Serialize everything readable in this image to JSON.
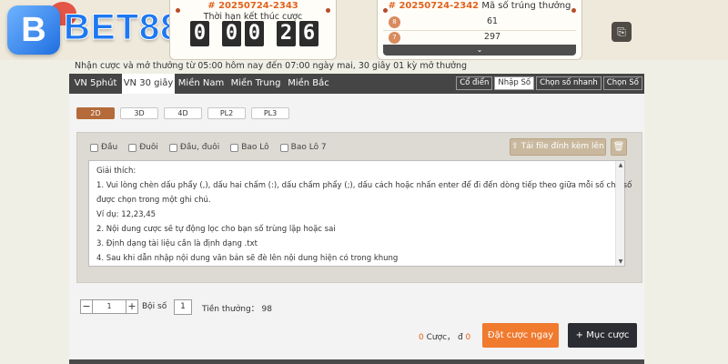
{
  "brand": {
    "logo_text": "BET88",
    "logo_mark": "B"
  },
  "current_round": {
    "id": "# 20250724-2343",
    "label": "Thời hạn kết thúc cược",
    "timer": [
      "0",
      "0",
      "0",
      "2",
      "6"
    ]
  },
  "last_result": {
    "id": "# 20250724-2342",
    "label": "Mã số trúng thưởng",
    "rows": [
      {
        "ball": "8",
        "value": "61"
      },
      {
        "ball": "7",
        "value": "297"
      }
    ],
    "expand_icon": "chevron-down-icon"
  },
  "notice": "Nhận cược và mở thưởng từ 05:00 hôm nay đến 07:00 ngày mai,   30 giây 01 kỳ mở thưởng",
  "tabs": [
    {
      "label": "VN 5phút"
    },
    {
      "label": "VN 30 giây"
    },
    {
      "label": "Miền Nam"
    },
    {
      "label": "Miền Trung"
    },
    {
      "label": "Miền Bắc"
    }
  ],
  "active_tab": "VN 30 giây",
  "modes": [
    {
      "label": "Cổ điển"
    },
    {
      "label": "Nhập Số"
    },
    {
      "label": "Chọn số nhanh"
    },
    {
      "label": "Chọn Số"
    }
  ],
  "active_mode": "Nhập Số",
  "sub_tabs": [
    {
      "label": "2D"
    },
    {
      "label": "3D"
    },
    {
      "label": "4D"
    },
    {
      "label": "PL2"
    },
    {
      "label": "PL3"
    }
  ],
  "active_sub_tab": "2D",
  "checkboxes": [
    {
      "label": "Đầu"
    },
    {
      "label": "Đuôi"
    },
    {
      "label": "Đầu, đuôi"
    },
    {
      "label": "Bao Lô"
    },
    {
      "label": "Bao Lô 7"
    }
  ],
  "upload_button": "Tải file đính kèm lên",
  "instructions": [
    "Giải thích:",
    "1. Vui lòng chèn dấu phẩy (,), dấu hai chấm (:), dấu chấm phẩy (;), dấu cách hoặc nhấn enter để đi đến dòng tiếp theo giữa mỗi số chữ số",
    "được chọn trong một ghi chú.",
    "Ví dụ: 12,23,45",
    "2. Nội dung cược sẽ tự động lọc cho bạn số trùng lặp hoặc sai",
    "3. Định dạng tài liệu cần là định dạng .txt",
    "4. Sau khi dẫn nhập nội dung văn bản sẽ đè lên nội dung hiện có trong khung"
  ],
  "stepper": {
    "minus": "−",
    "value": "1",
    "plus": "+"
  },
  "multiplier": {
    "label": "Bội số",
    "value": "1"
  },
  "reward": "Tiền thưởng： 98",
  "summary": {
    "count": "0",
    "count_label": "Cược，",
    "amount": "0",
    "currency_symbol": "đ"
  },
  "bet_button": "Đặt cược ngay",
  "list_button": "Mục cược",
  "list_button_icon": "+"
}
